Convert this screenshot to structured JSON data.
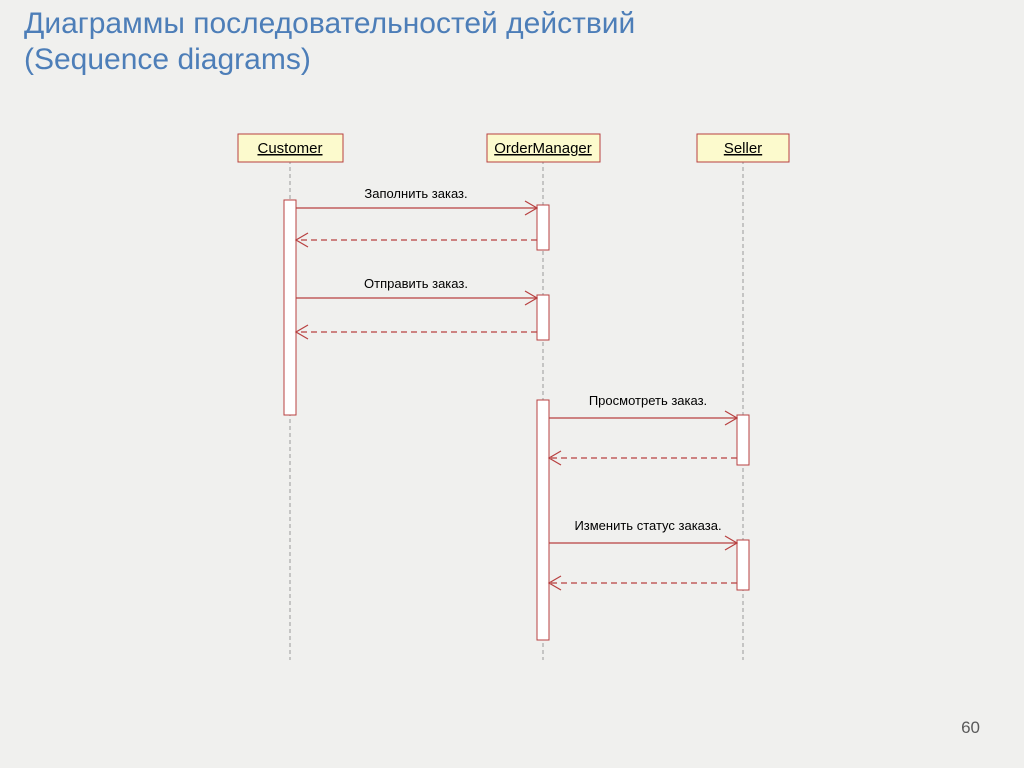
{
  "title_line1": "Диаграммы последовательностей действий",
  "title_line2": "(Sequence diagrams)",
  "page_number": "60",
  "diagram": {
    "participants": {
      "customer": "Customer",
      "orderManager": "OrderManager",
      "seller": "Seller"
    },
    "messages": {
      "fillOrder": "Заполнить заказ.",
      "sendOrder": "Отправить заказ.",
      "viewOrder": "Просмотреть заказ.",
      "changeStatus": "Изменить статус заказа."
    }
  }
}
